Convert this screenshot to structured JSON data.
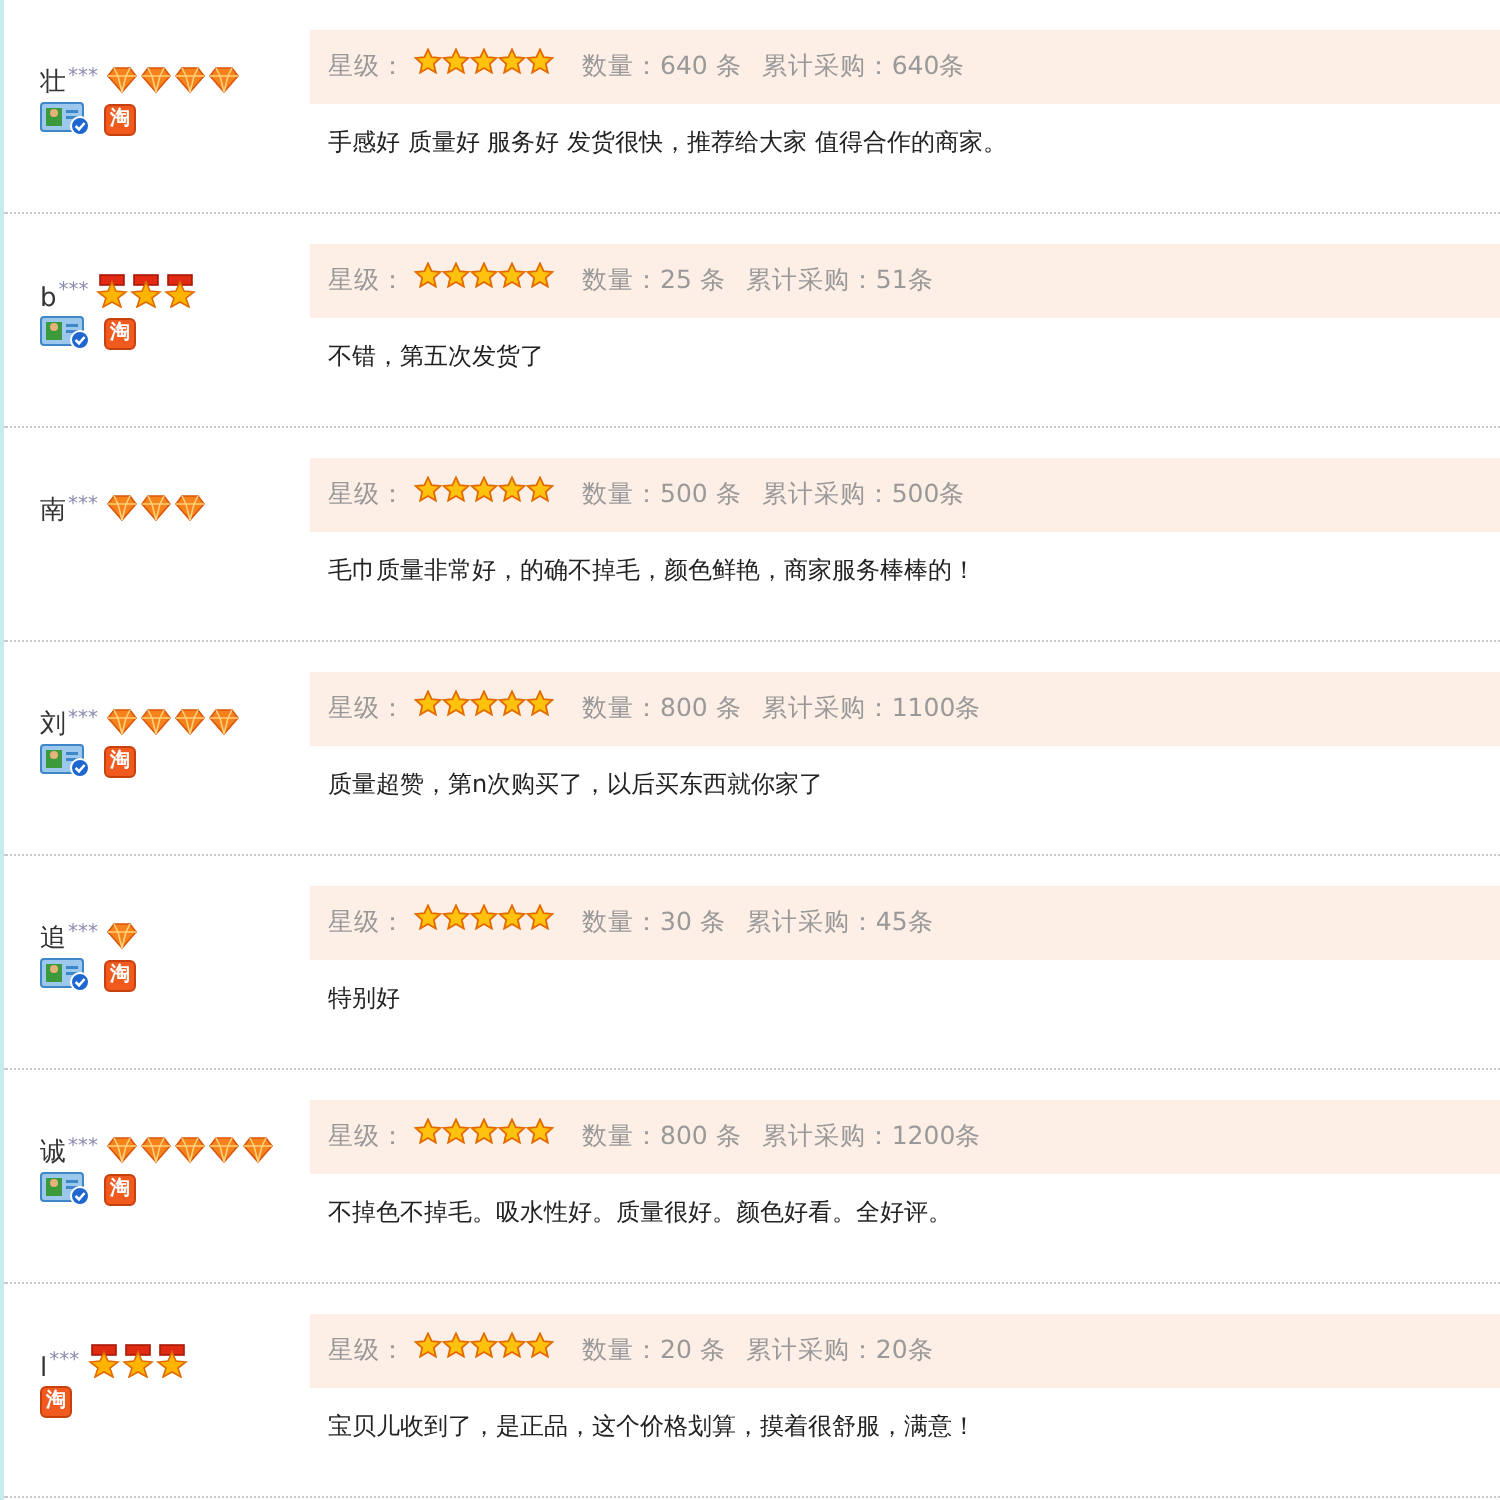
{
  "reviews": [
    {
      "user": "壮",
      "mask": "***",
      "rank": [
        {
          "kind": "diamond"
        },
        {
          "kind": "diamond"
        },
        {
          "kind": "diamond"
        },
        {
          "kind": "diamond"
        }
      ],
      "id_verified": true,
      "shop_badge": "淘",
      "rating_label": "星级：",
      "stars": 5,
      "quantity": "数量：640 条",
      "total": "累计采购：640条",
      "comment": "手感好 质量好 服务好 发货很快，推荐给大家 值得合作的商家。"
    },
    {
      "user": "b",
      "mask": "***",
      "rank": [
        {
          "kind": "crown"
        },
        {
          "kind": "crown"
        },
        {
          "kind": "crown"
        }
      ],
      "id_verified": true,
      "shop_badge": "淘",
      "rating_label": "星级：",
      "stars": 5,
      "quantity": "数量：25 条",
      "total": "累计采购：51条",
      "comment": "不错，第五次发货了"
    },
    {
      "user": "南",
      "mask": "***",
      "rank": [
        {
          "kind": "diamond"
        },
        {
          "kind": "diamond"
        },
        {
          "kind": "diamond"
        }
      ],
      "id_verified": false,
      "rating_label": "星级：",
      "stars": 5,
      "quantity": "数量：500 条",
      "total": "累计采购：500条",
      "comment": "毛巾质量非常好，的确不掉毛，颜色鲜艳，商家服务棒棒的！"
    },
    {
      "user": "刘",
      "mask": "***",
      "rank": [
        {
          "kind": "diamond"
        },
        {
          "kind": "diamond"
        },
        {
          "kind": "diamond"
        },
        {
          "kind": "diamond"
        }
      ],
      "id_verified": true,
      "shop_badge": "淘",
      "rating_label": "星级：",
      "stars": 5,
      "quantity": "数量：800 条",
      "total": "累计采购：1100条",
      "comment": "质量超赞，第n次购买了，以后买东西就你家了"
    },
    {
      "user": "追",
      "mask": "***",
      "rank": [
        {
          "kind": "diamond"
        }
      ],
      "id_verified": true,
      "shop_badge": "淘",
      "rating_label": "星级：",
      "stars": 5,
      "quantity": "数量：30 条",
      "total": "累计采购：45条",
      "comment": "特别好"
    },
    {
      "user": "诚",
      "mask": "***",
      "rank": [
        {
          "kind": "diamond"
        },
        {
          "kind": "diamond"
        },
        {
          "kind": "diamond"
        },
        {
          "kind": "diamond"
        },
        {
          "kind": "diamond"
        }
      ],
      "id_verified": true,
      "shop_badge": "淘",
      "rating_label": "星级：",
      "stars": 5,
      "quantity": "数量：800 条",
      "total": "累计采购：1200条",
      "comment": "不掉色不掉毛。吸水性好。质量很好。颜色好看。全好评。"
    },
    {
      "user": "l",
      "mask": "***",
      "rank": [
        {
          "kind": "crown"
        },
        {
          "kind": "crown"
        },
        {
          "kind": "crown"
        }
      ],
      "id_verified": false,
      "shop_badge": "淘",
      "rating_label": "星级：",
      "stars": 5,
      "quantity": "数量：20 条",
      "total": "累计采购：20条",
      "comment": "宝贝儿收到了，是正品，这个价格划算，摸着很舒服，满意！"
    }
  ]
}
